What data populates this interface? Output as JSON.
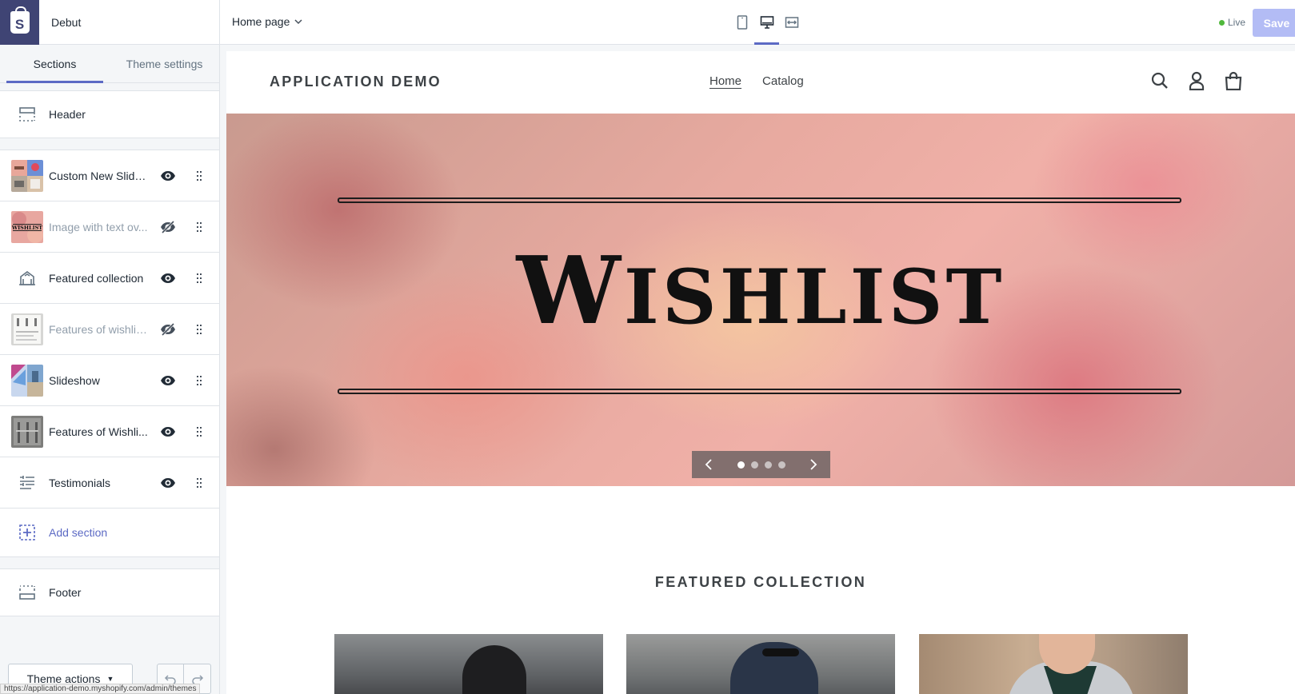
{
  "app": {
    "theme_name": "Debut"
  },
  "sidebar": {
    "tabs": [
      {
        "label": "Sections",
        "active": true
      },
      {
        "label": "Theme settings",
        "active": false
      }
    ],
    "header_section": {
      "label": "Header",
      "icon": "header-layout-icon"
    },
    "sections": [
      {
        "label": "Custom New Slide...",
        "thumb": "collage-thumbnail",
        "visible": true
      },
      {
        "label": "Image with text ov...",
        "thumb": "wishlist-banner-thumbnail",
        "visible": false
      },
      {
        "label": "Featured collection",
        "icon": "collection-icon",
        "visible": true
      },
      {
        "label": "Features of wishlis...",
        "thumb": "document-thumbnail",
        "visible": false
      },
      {
        "label": "Slideshow",
        "thumb": "slideshow-thumbnail",
        "visible": true
      },
      {
        "label": "Features of Wishli...",
        "thumb": "grey-thumbnail",
        "visible": true
      },
      {
        "label": "Testimonials",
        "icon": "text-lines-icon",
        "visible": true
      }
    ],
    "add_section": {
      "label": "Add section",
      "icon": "add-section-icon"
    },
    "footer_section": {
      "label": "Footer",
      "icon": "footer-layout-icon"
    },
    "theme_actions_label": "Theme actions",
    "status_url": "https://application-demo.myshopify.com/admin/themes"
  },
  "topbar": {
    "page_select": "Home page",
    "devices": [
      "mobile-icon",
      "desktop-icon",
      "fullscreen-icon"
    ],
    "active_device": "desktop-icon",
    "live_label": "Live",
    "save_label": "Save"
  },
  "preview": {
    "store_name": "APPLICATION DEMO",
    "nav": [
      {
        "label": "Home",
        "active": true
      },
      {
        "label": "Catalog",
        "active": false
      }
    ],
    "hero": {
      "text_first": "W",
      "text_rest": "ISHLIST",
      "slide_count": 4,
      "active_slide": 1
    },
    "featured_title": "FEATURED COLLECTION"
  },
  "colors": {
    "accent": "#5c6ac4",
    "logo_bg": "#3f4474",
    "live_dot": "#50b83c",
    "save_disabled": "#b3bcf5"
  }
}
